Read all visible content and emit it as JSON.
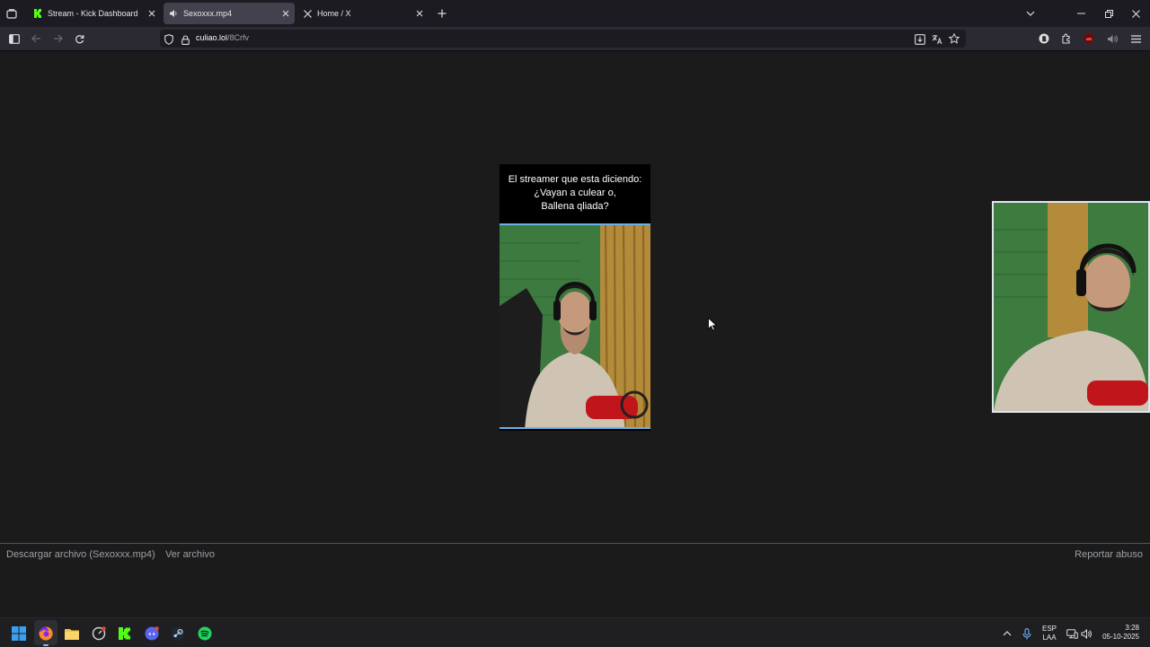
{
  "browser": {
    "tabs": [
      {
        "label": "Stream - Kick Dashboard",
        "icon": "kick-logo-icon",
        "active": false
      },
      {
        "label": "Sexoxxx.mp4",
        "icon": "speaker-icon",
        "active": true
      },
      {
        "label": "Home / X",
        "icon": "x-logo-icon",
        "active": false
      }
    ],
    "url": {
      "domain": "culiao.lol",
      "path": "/8Crfv"
    }
  },
  "video": {
    "caption": "El streamer que esta diciendo:\n¿Vayan a culear o,\nBallena qliada?"
  },
  "footer": {
    "download_label": "Descargar archivo (Sexoxxx.mp4)",
    "view_label": "Ver archivo",
    "report_label": "Reportar abuso"
  },
  "taskbar": {
    "lang_top": "ESP",
    "lang_bottom": "LAA",
    "time": "3:28",
    "date": "05-10-2025"
  },
  "colors": {
    "accent": "#6cb0e6",
    "kick_green": "#53fc18",
    "spotify_green": "#1ed760"
  }
}
